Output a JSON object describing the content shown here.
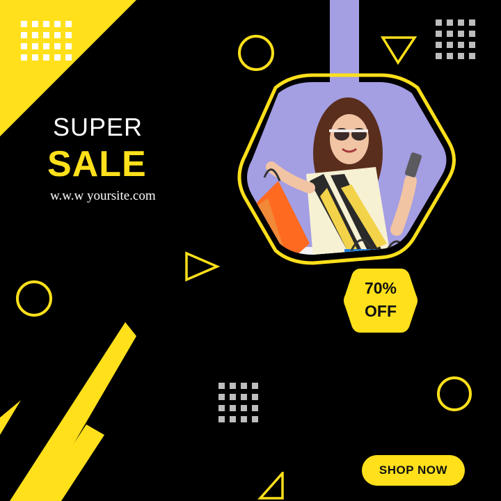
{
  "headline": {
    "line1": "SUPER",
    "line2": "SALE",
    "website": "w.w.w yoursite.com"
  },
  "discount_badge": {
    "line1": "70%",
    "line2": "OFF"
  },
  "cta": {
    "label": "SHOP NOW"
  },
  "colors": {
    "background": "#000000",
    "accent_yellow": "#ffe01b",
    "lavender": "#a49ee3",
    "dots_white": "#ffffff",
    "dots_gray": "#bdbdbd"
  },
  "decorations": {
    "dot_grids": [
      "white-dot-grid",
      "gray-dot-grid",
      "gray-dot-grid"
    ],
    "icons": [
      "circle-outline-icon",
      "triangle-outline-icon"
    ]
  },
  "photo": {
    "subject": "woman-with-shopping-bags-photo"
  }
}
